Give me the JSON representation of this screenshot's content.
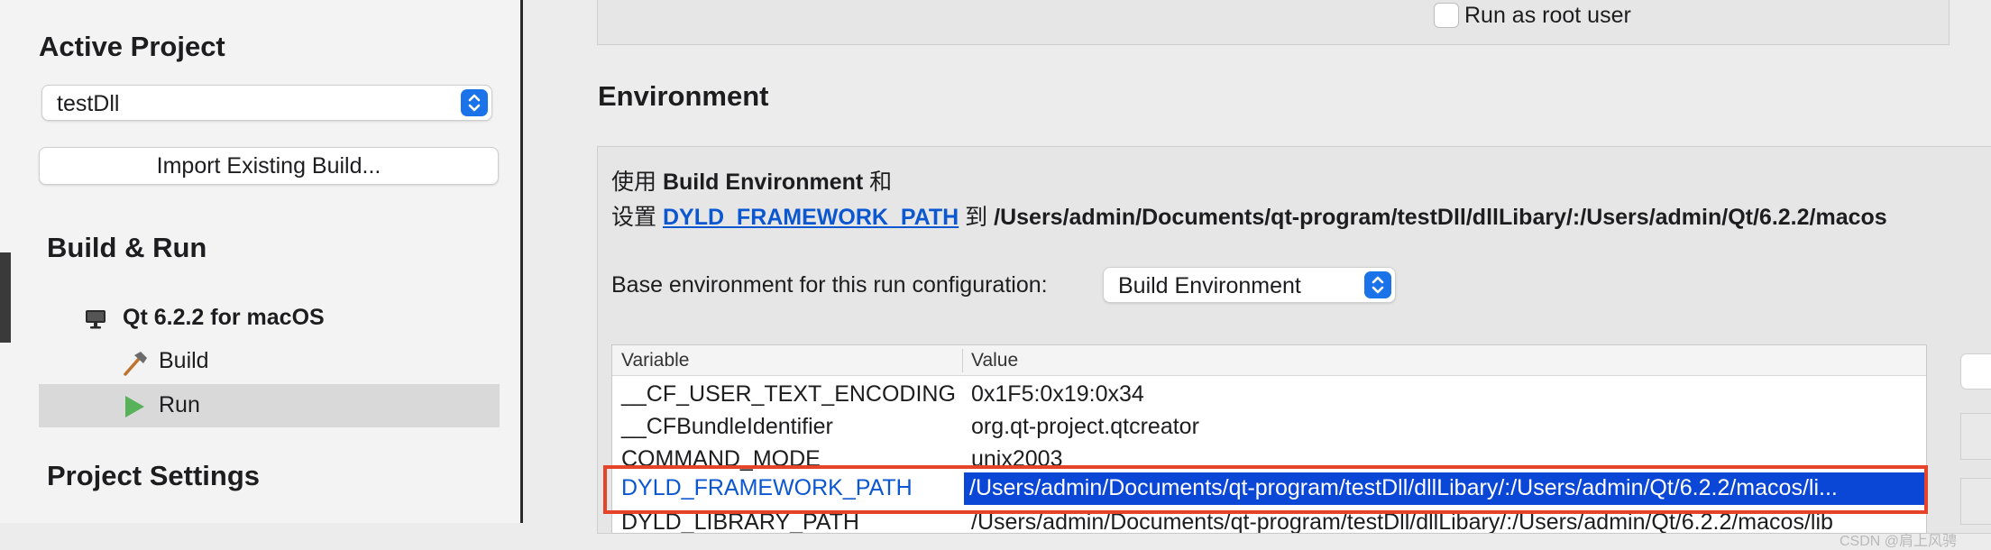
{
  "sidebar": {
    "active_project_title": "Active Project",
    "project_select_value": "testDll",
    "import_button_label": "Import Existing Build...",
    "build_run_title": "Build & Run",
    "kit_label": "Qt 6.2.2 for macOS",
    "build_label": "Build",
    "run_label": "Run",
    "project_settings_title": "Project Settings"
  },
  "main": {
    "run_as_root_label": "Run as root user",
    "environment_title": "Environment",
    "env_line1_prefix": "使用",
    "env_line1_bold": "Build Environment",
    "env_line1_suffix": "和",
    "env_line2_prefix": "设置",
    "env_line2_link": "DYLD_FRAMEWORK_PATH",
    "env_line2_mid": "到",
    "env_line2_path": "/Users/admin/Documents/qt-program/testDll/dllLibary/:/Users/admin/Qt/6.2.2/macos",
    "base_env_label": "Base environment for this run configuration:",
    "base_env_value": "Build Environment"
  },
  "table": {
    "col_variable": "Variable",
    "col_value": "Value",
    "rows": [
      {
        "variable": "__CF_USER_TEXT_ENCODING",
        "value": "0x1F5:0x19:0x34"
      },
      {
        "variable": "__CFBundleIdentifier",
        "value": "org.qt-project.qtcreator"
      },
      {
        "variable": "COMMAND_MODE",
        "value": "unix2003"
      },
      {
        "variable": "DYLD_FRAMEWORK_PATH",
        "value": "/Users/admin/Documents/qt-program/testDll/dllLibary/:/Users/admin/Qt/6.2.2/macos/li..."
      },
      {
        "variable": "DYLD_LIBRARY_PATH",
        "value": "/Users/admin/Documents/qt-program/testDll/dllLibary/:/Users/admin/Qt/6.2.2/macos/lib"
      }
    ]
  },
  "watermark": "CSDN @肩上风骋",
  "colors": {
    "accent": "#1a73e8",
    "selection": "#0b47d6",
    "link": "#0b57d0",
    "highlight": "#e5432a"
  },
  "icons": [
    "updown-chevron-icon",
    "monitor-icon",
    "hammer-icon",
    "play-icon"
  ]
}
